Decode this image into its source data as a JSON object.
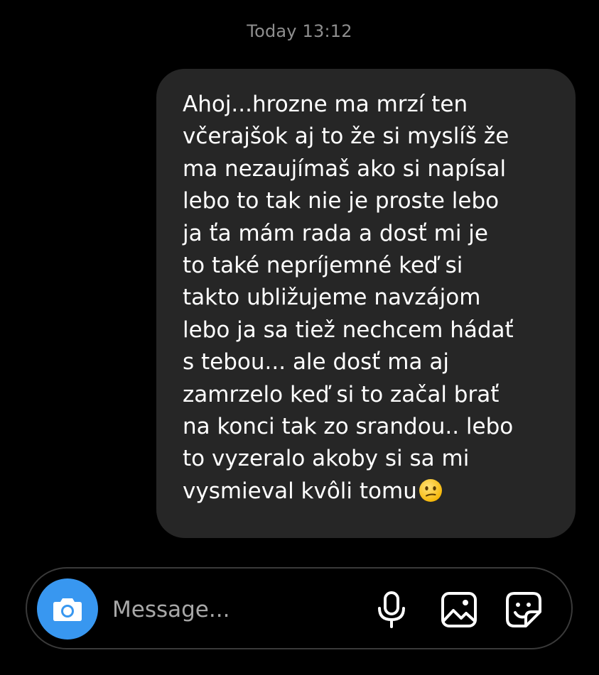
{
  "conversation": {
    "timestamp": "Today 13:12",
    "message": {
      "lines": [
        "Ahoj...hrozne ma mrzí ten",
        "včerajšok aj to že si myslíš že",
        "ma nezaujímaš ako si  napísal",
        "lebo to tak nie je proste lebo",
        "ja ťa mám rada a dosť mi je",
        "to také nepríjemné keď si",
        "takto ubližujeme navzájom",
        "lebo ja sa tiež nechcem hádať",
        "s tebou... ale dosť ma aj",
        "zamrzelo keď si to začal brať",
        "na konci tak zo srandou.. lebo",
        "to vyzeralo akoby si sa mi",
        "vysmieval kvôli tomu"
      ],
      "trailing_emoji": "confused-face-emoji"
    }
  },
  "composer": {
    "placeholder": "Message...",
    "value": "",
    "icons": {
      "camera": "camera-icon",
      "mic": "microphone-icon",
      "gallery": "gallery-icon",
      "sticker": "sticker-icon"
    }
  },
  "colors": {
    "background": "#000000",
    "bubble": "#262626",
    "timestamp": "#8e8e8e",
    "accent": "#3897f0",
    "placeholder": "#a8a8a8",
    "composer_border": "#3a3a3a"
  }
}
